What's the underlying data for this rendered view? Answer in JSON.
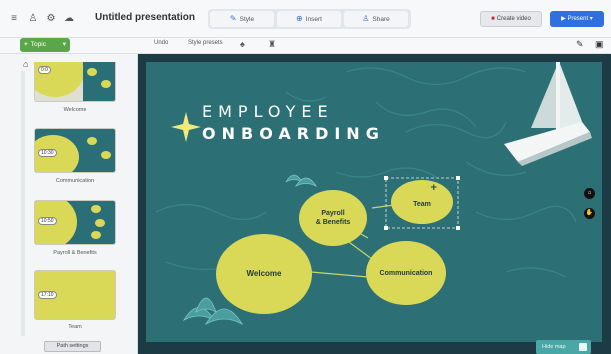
{
  "topbar": {
    "icons": [
      "menu-icon",
      "user-icon",
      "settings-icon",
      "cloud-icon"
    ],
    "title": "Untitled presentation",
    "tabs": [
      {
        "label": "Style",
        "icon": "pencil-icon"
      },
      {
        "label": "Insert",
        "icon": "plus-circle-icon"
      },
      {
        "label": "Share",
        "icon": "person-add-icon"
      }
    ],
    "create_video_label": "Create video",
    "present_label": "Present"
  },
  "toolbar": {
    "topic_label": "Topic",
    "undo_label": "Undo",
    "style_presets_label": "Style presets"
  },
  "thumbnails": [
    {
      "chip": "0:0",
      "label": "Welcome"
    },
    {
      "chip": "10:30",
      "label": "Communication"
    },
    {
      "chip": "10:50",
      "label": "Payroll & Benefits"
    },
    {
      "chip": "17:10",
      "label": "Team"
    }
  ],
  "path_settings_label": "Path settings",
  "slide": {
    "title_line1": "EMPLOYEE",
    "title_line2": "ONBOARDING",
    "nodes": [
      {
        "id": "welcome",
        "label": "Welcome"
      },
      {
        "id": "payroll",
        "label": "Payroll\n& Benefits"
      },
      {
        "id": "team",
        "label": "Team"
      },
      {
        "id": "communication",
        "label": "Communication"
      }
    ]
  },
  "bottom_pill_label": "Hide map",
  "colors": {
    "accent": "#2f6fe0",
    "topic_green": "#5aa74a",
    "slide_teal": "#2c7076",
    "blob_yellow": "#d9d957"
  }
}
